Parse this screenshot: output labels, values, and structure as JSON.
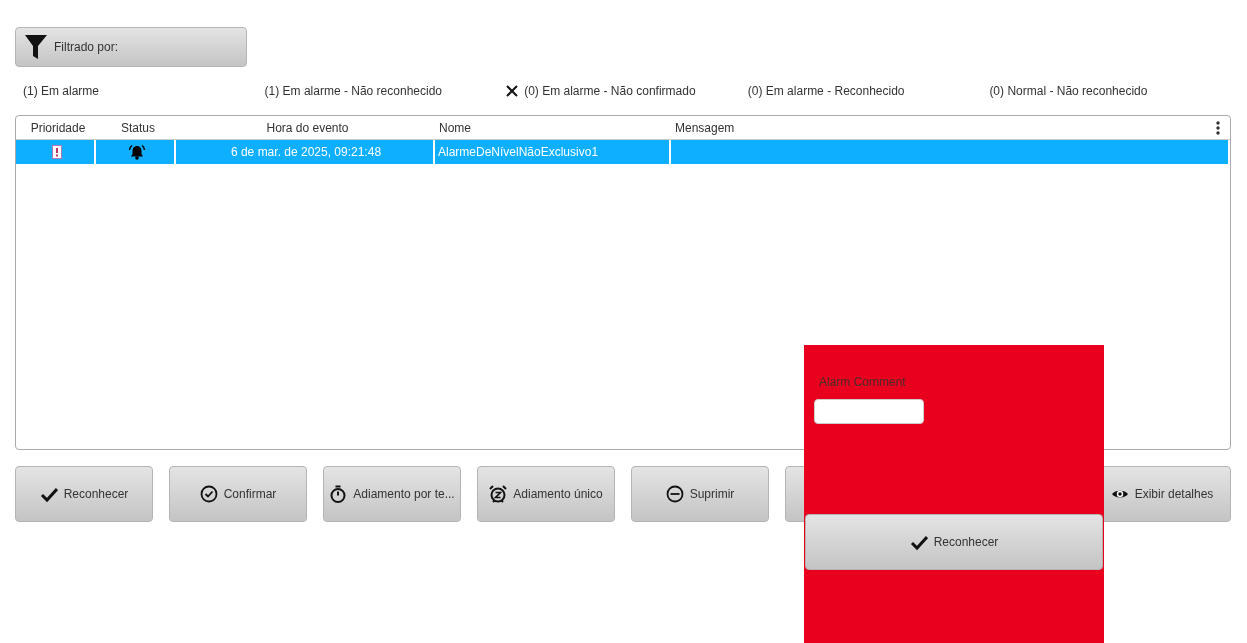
{
  "filter_button": {
    "label": "Filtrado por:"
  },
  "status_counts": [
    {
      "label": "(1) Em alarme",
      "excluded": false
    },
    {
      "label": "(1) Em alarme - Não reconhecido",
      "excluded": false
    },
    {
      "label": "(0) Em alarme - Não confirmado",
      "excluded": true
    },
    {
      "label": "(0) Em alarme - Reconhecido",
      "excluded": false
    },
    {
      "label": "(0) Normal - Não reconhecido",
      "excluded": false
    }
  ],
  "table": {
    "columns": [
      "Prioridade",
      "Status",
      "Hora do evento",
      "Nome",
      "Mensagem"
    ],
    "rows": [
      {
        "selected": true,
        "time": "6 de mar. de 2025, 09:21:48",
        "name": "AlarmeDeNívelNãoExclusivo1",
        "message": ""
      }
    ]
  },
  "buttons": [
    {
      "kind": "check",
      "label": "Reconhecer"
    },
    {
      "kind": "circle-check",
      "label": "Confirmar"
    },
    {
      "kind": "stopwatch",
      "label": "Adiamento por te..."
    },
    {
      "kind": "snooze",
      "label": "Adiamento único"
    },
    {
      "kind": "minus",
      "label": "Suprimir"
    },
    {
      "kind": "covered"
    },
    {
      "kind": "eye",
      "label": "Exibir detalhes"
    }
  ],
  "comment_popup": {
    "label": "Alarm Comment",
    "button": {
      "label": "Reconhecer"
    }
  }
}
